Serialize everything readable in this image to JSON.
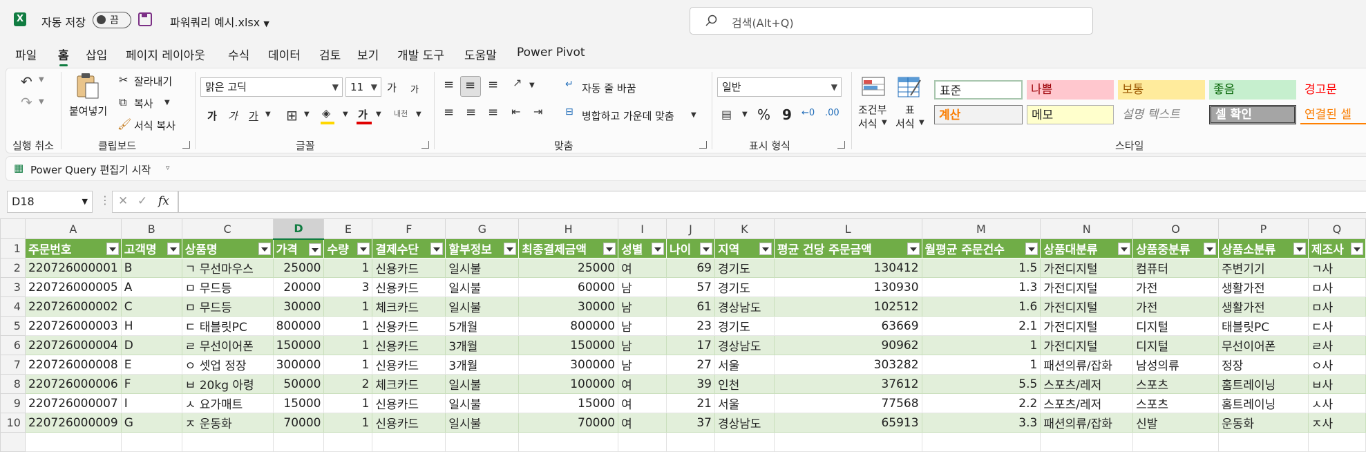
{
  "titlebar": {
    "autosave_label": "자동 저장",
    "autosave_state": "끔",
    "filename": "파워쿼리 예시.xlsx",
    "search_placeholder": "검색(Alt+Q)"
  },
  "tabs": [
    "파일",
    "홈",
    "삽입",
    "페이지 레이아웃",
    "수식",
    "데이터",
    "검토",
    "보기",
    "개발 도구",
    "도움말",
    "Power Pivot"
  ],
  "ribbon": {
    "undo_group": "실행 취소",
    "clipboard": {
      "paste": "붙여넣기",
      "cut": "잘라내기",
      "copy": "복사",
      "format_painter": "서식 복사",
      "group": "클립보드"
    },
    "font": {
      "name": "맑은 고딕",
      "size": "11",
      "grow": "가",
      "shrink": "가",
      "bold": "가",
      "italic": "가",
      "underline": "가",
      "font_color_glyph": "가",
      "phonetic": "내천",
      "group": "글꼴"
    },
    "alignment": {
      "wrap": "자동 줄 바꿈",
      "merge": "병합하고 가운데 맞춤",
      "group": "맞춤"
    },
    "number": {
      "format": "일반",
      "percent": "%",
      "comma": "9",
      "group": "표시 형식"
    },
    "styles": {
      "conditional": [
        "조건부",
        "서식"
      ],
      "table": [
        "표",
        "서식"
      ],
      "cells": [
        "표준",
        "나쁨",
        "보통",
        "좋음",
        "경고문",
        "계산",
        "메모",
        "설명 텍스트",
        "셀 확인",
        "연결된 셀"
      ],
      "group": "스타일"
    }
  },
  "command_bar": {
    "power_query": "Power Query 편집기 시작"
  },
  "formula_bar": {
    "name_box": "D18",
    "fx": "fx",
    "value": ""
  },
  "grid": {
    "columns": [
      "A",
      "B",
      "C",
      "D",
      "E",
      "F",
      "G",
      "H",
      "I",
      "J",
      "K",
      "L",
      "M",
      "N",
      "O",
      "P",
      "Q"
    ],
    "selected_column": "D",
    "row_numbers": [
      "1",
      "2",
      "3",
      "4",
      "5",
      "6",
      "7",
      "8",
      "9",
      "10"
    ],
    "headers": [
      "주문번호",
      "고객명",
      "상품명",
      "가격",
      "수량",
      "결제수단",
      "할부정보",
      "최종결제금액",
      "성별",
      "나이",
      "지역",
      "평균 건당 주문금액",
      "월평균 주문건수",
      "상품대분류",
      "상품중분류",
      "상품소분류",
      "제조사"
    ],
    "rows": [
      [
        "220726000001",
        "B",
        "ㄱ 무선마우스",
        "25000",
        "1",
        "신용카드",
        "일시불",
        "25000",
        "여",
        "69",
        "경기도",
        "130412",
        "1.5",
        "가전디지털",
        "컴퓨터",
        "주변기기",
        "ㄱ사"
      ],
      [
        "220726000005",
        "A",
        "ㅁ 무드등",
        "20000",
        "3",
        "신용카드",
        "일시불",
        "60000",
        "남",
        "57",
        "경기도",
        "130930",
        "1.3",
        "가전디지털",
        "가전",
        "생활가전",
        "ㅁ사"
      ],
      [
        "220726000002",
        "C",
        "ㅁ 무드등",
        "30000",
        "1",
        "체크카드",
        "일시불",
        "30000",
        "남",
        "61",
        "경상남도",
        "102512",
        "1.6",
        "가전디지털",
        "가전",
        "생활가전",
        "ㅁ사"
      ],
      [
        "220726000003",
        "H",
        "ㄷ 태블릿PC",
        "800000",
        "1",
        "신용카드",
        "5개월",
        "800000",
        "남",
        "23",
        "경기도",
        "63669",
        "2.1",
        "가전디지털",
        "디지털",
        "태블릿PC",
        "ㄷ사"
      ],
      [
        "220726000004",
        "D",
        "ㄹ 무선이어폰",
        "150000",
        "1",
        "신용카드",
        "3개월",
        "150000",
        "남",
        "17",
        "경상남도",
        "90962",
        "1",
        "가전디지털",
        "디지털",
        "무선이어폰",
        "ㄹ사"
      ],
      [
        "220726000008",
        "E",
        "ㅇ 셋업 정장",
        "300000",
        "1",
        "신용카드",
        "3개월",
        "300000",
        "남",
        "27",
        "서울",
        "303282",
        "1",
        "패션의류/잡화",
        "남성의류",
        "정장",
        "ㅇ사"
      ],
      [
        "220726000006",
        "F",
        "ㅂ 20kg 아령",
        "50000",
        "2",
        "체크카드",
        "일시불",
        "100000",
        "여",
        "39",
        "인천",
        "37612",
        "5.5",
        "스포츠/레저",
        "스포츠",
        "홈트레이닝",
        "ㅂ사"
      ],
      [
        "220726000007",
        "I",
        "ㅅ 요가매트",
        "15000",
        "1",
        "신용카드",
        "일시불",
        "15000",
        "여",
        "21",
        "서울",
        "77568",
        "2.2",
        "스포츠/레저",
        "스포츠",
        "홈트레이닝",
        "ㅅ사"
      ],
      [
        "220726000009",
        "G",
        "ㅈ 운동화",
        "70000",
        "1",
        "신용카드",
        "일시불",
        "70000",
        "여",
        "37",
        "경상남도",
        "65913",
        "3.3",
        "패션의류/잡화",
        "신발",
        "운동화",
        "ㅈ사"
      ]
    ],
    "numeric_columns": [
      3,
      4,
      7,
      9,
      11,
      12
    ]
  }
}
